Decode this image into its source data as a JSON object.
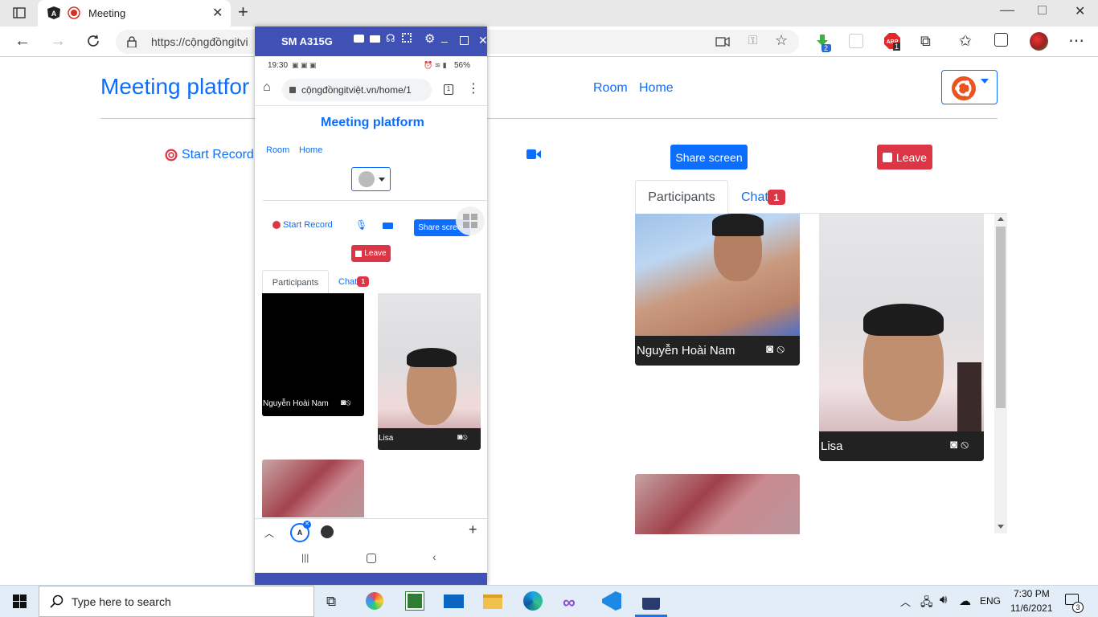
{
  "browser": {
    "tab_title": "Meeting",
    "url": "https://cộngđồngitviệt.vn/home/1",
    "url_visible": "https://cộngđồngitvi",
    "ext_badge_1": "2",
    "ext_badge_2": "1"
  },
  "app": {
    "brand": "Meeting platform",
    "brand_visible": "Meeting platfor",
    "nav": [
      "Room",
      "Home"
    ],
    "start_record": "Start Record",
    "share_screen": "Share screen",
    "leave": "Leave",
    "tabs": {
      "participants": "Participants",
      "chat": "Chat",
      "chat_badge": "1"
    },
    "participants": [
      {
        "name": "Nguyễn Hoài Nam"
      },
      {
        "name": "Lisa"
      },
      {
        "name": ""
      }
    ]
  },
  "phone": {
    "device_name": "SM A315G",
    "status_time": "19:30",
    "battery": "56%",
    "url": "cộngđồngitviệt.vn/home/1",
    "tab_count": "1"
  },
  "taskbar": {
    "search_placeholder": "Type here to search",
    "lang": "ENG",
    "time": "7:30 PM",
    "date": "11/6/2021",
    "notif_count": "3"
  },
  "colors": {
    "primary": "#0d6efd",
    "danger": "#dc3545",
    "scrcpy": "#3f51b5"
  }
}
